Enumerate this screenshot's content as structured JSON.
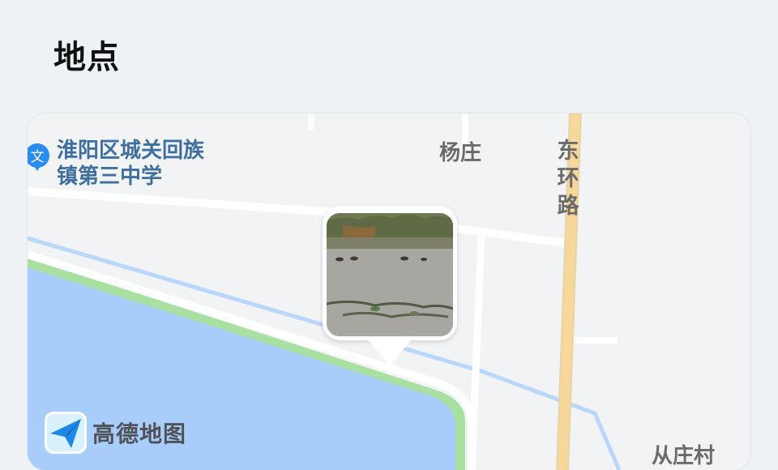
{
  "header": {
    "title": "地点"
  },
  "map": {
    "poi": {
      "label": "淮阳区城关回族镇第三中学",
      "pin_glyph": "文",
      "pin_icon": "school-pin-icon",
      "pin_color": "#2a8cf0"
    },
    "labels": {
      "village_top": "杨庄",
      "road_east": "东环路",
      "village_bottom": "从庄村"
    },
    "photo_marker": {
      "icon": "photo-thumbnail"
    },
    "brand": {
      "name": "高德地图",
      "logo_icon": "amap-logo-icon"
    },
    "colors": {
      "water": "#a9cdfb",
      "land": "#f2f3f4",
      "main_road": "#f7d79a",
      "shore": "#a7e0a0"
    }
  }
}
